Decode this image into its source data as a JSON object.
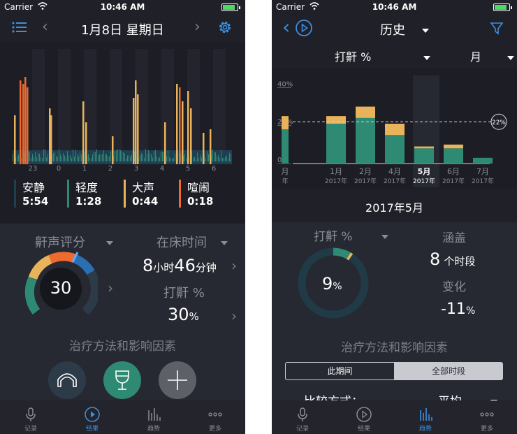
{
  "status": {
    "carrier": "Carrier",
    "time": "10:46 AM"
  },
  "left": {
    "nav": {
      "title": "1月8日 星期日"
    },
    "hour_ticks": [
      "23",
      "0",
      "1",
      "2",
      "3",
      "4",
      "5",
      "6"
    ],
    "legend": [
      {
        "name": "安静",
        "value": "5:54",
        "color": "#1f3f52"
      },
      {
        "name": "轻度",
        "value": "1:28",
        "color": "#2f8a73"
      },
      {
        "name": "大声",
        "value": "0:44",
        "color": "#e8b35a"
      },
      {
        "name": "喧闹",
        "value": "0:18",
        "color": "#ef6a2f"
      }
    ],
    "score": {
      "title": "鼾声评分",
      "value": "30"
    },
    "bed": {
      "title": "在床时间",
      "h": "8",
      "h_unit": "小时",
      "m": "46",
      "m_unit": "分钟"
    },
    "snore": {
      "title": "打鼾 %",
      "value": "30",
      "unit": "%"
    },
    "factors_title": "治疗方法和影响因素"
  },
  "right": {
    "nav": {
      "title": "历史"
    },
    "metric": {
      "label": "打鼾 %",
      "period": "月"
    },
    "chart_data": {
      "type": "bar",
      "categories": [
        "月",
        "1月",
        "2月",
        "4月",
        "5月",
        "6月",
        "7月"
      ],
      "years": [
        "年",
        "2017年",
        "2017年",
        "2017年",
        "2017年",
        "2017年",
        "2017年"
      ],
      "series": [
        {
          "values": [
            18,
            21,
            24,
            15,
            8,
            8,
            3
          ]
        },
        {
          "values": [
            7,
            4,
            6,
            6,
            1,
            2,
            0
          ]
        }
      ],
      "yticks": [
        "0%",
        "20%",
        "40%"
      ],
      "ylim": [
        0,
        42
      ],
      "reference_value": 22,
      "reference_label": "22%",
      "selected_index": 4
    },
    "selected_title": "2017年5月",
    "snore": {
      "title": "打鼾 %",
      "value": "9",
      "unit": "%"
    },
    "coverage": {
      "title": "涵盖",
      "value": "8",
      "unit": "个时段"
    },
    "change": {
      "title": "变化",
      "value": "-11",
      "unit": "%"
    },
    "factors_title": "治疗方法和影响因素",
    "segments": [
      "此期间",
      "全部时段"
    ],
    "compare": {
      "label": "比较方式：",
      "value": "平均"
    }
  },
  "tabs": [
    "记录",
    "结果",
    "趋势",
    "更多"
  ],
  "colors": {
    "accent": "#3d8fe0",
    "teal": "#2f8a73",
    "orange": "#ef6a2f",
    "yellow": "#e8b35a",
    "bg": "#1f2028"
  }
}
